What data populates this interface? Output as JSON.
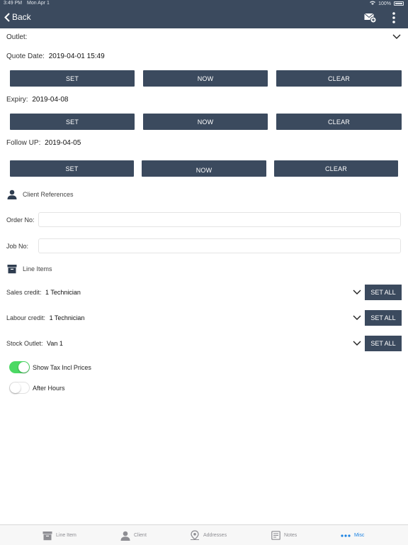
{
  "status_bar": {
    "time": "3:49 PM",
    "date": "Mon Apr 1",
    "battery": "100%"
  },
  "header": {
    "back_label": "Back",
    "compose_icon": "mail-send-icon",
    "more_icon": "more-vertical-icon"
  },
  "outlet": {
    "label": "Outlet:"
  },
  "quote_date": {
    "label": "Quote Date:",
    "value": "2019-04-01 15:49",
    "set": "SET",
    "now": "NOW",
    "clear": "CLEAR"
  },
  "expiry": {
    "label": "Expiry:",
    "value": "2019-04-08",
    "set": "SET",
    "now": "NOW",
    "clear": "CLEAR"
  },
  "follow_up": {
    "label": "Follow UP:",
    "value": "2019-04-05",
    "set": "SET",
    "now": "NOW",
    "clear": "CLEAR"
  },
  "client_references": {
    "title": "Client References",
    "order_no": {
      "label": "Order No:",
      "value": ""
    },
    "job_no": {
      "label": "Job No:",
      "value": ""
    }
  },
  "line_items": {
    "title": "Line Items",
    "sales_credit": {
      "label": "Sales credit:",
      "value": "1 Technician",
      "button": "SET ALL"
    },
    "labour_credit": {
      "label": "Labour credit:",
      "value": "1 Technician",
      "button": "SET ALL"
    },
    "stock_outlet": {
      "label": "Stock Outlet:",
      "value": "Van 1",
      "button": "SET ALL"
    }
  },
  "toggles": {
    "tax_incl": {
      "label": "Show Tax Incl Prices",
      "on": true
    },
    "after_hours": {
      "label": "After Hours",
      "on": false
    }
  },
  "tabbar": {
    "tabs": [
      {
        "label": "Line Item",
        "icon": "archive-box-icon",
        "active": false
      },
      {
        "label": "Client",
        "icon": "person-icon",
        "active": false
      },
      {
        "label": "Addresses",
        "icon": "map-pin-icon",
        "active": false
      },
      {
        "label": "Notes",
        "icon": "notes-icon",
        "active": false
      },
      {
        "label": "Misc",
        "icon": "ellipsis-icon",
        "active": true
      }
    ]
  },
  "colors": {
    "navy": "#3b4a5e",
    "toggle_on": "#4cd964",
    "tab_active": "#1a82e2"
  }
}
